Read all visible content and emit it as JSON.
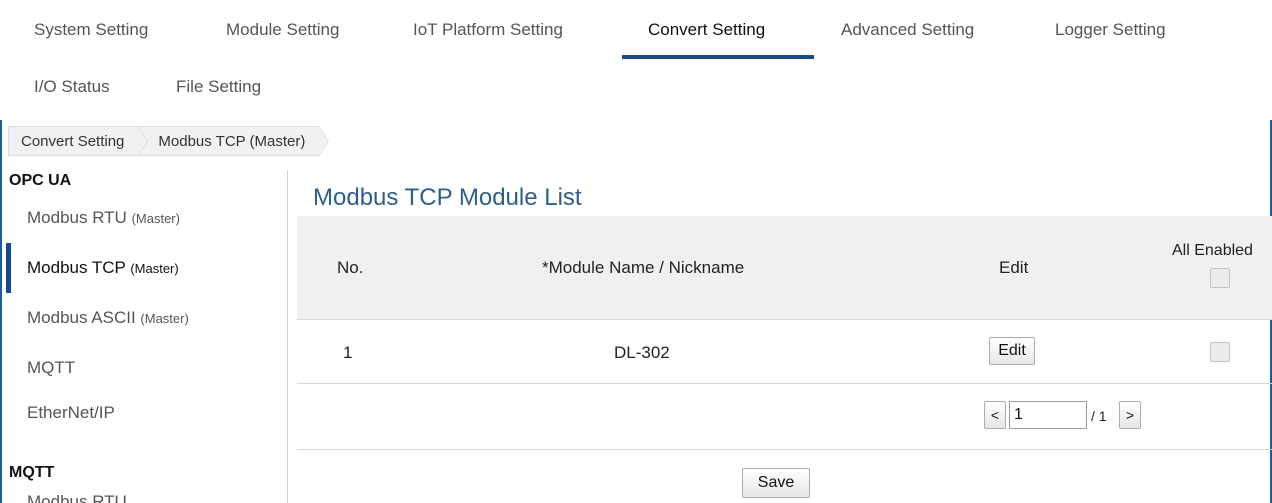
{
  "topnav": {
    "items": [
      {
        "label": "System Setting"
      },
      {
        "label": "Module Setting"
      },
      {
        "label": "IoT Platform Setting"
      },
      {
        "label": "Convert Setting"
      },
      {
        "label": "Advanced Setting"
      },
      {
        "label": "Logger Setting"
      },
      {
        "label": "I/O Status"
      },
      {
        "label": "File Setting"
      }
    ],
    "active": "Convert Setting"
  },
  "breadcrumb": [
    "Convert Setting",
    "Modbus TCP (Master)"
  ],
  "sidebar": {
    "sections": [
      {
        "heading": "OPC UA",
        "items": [
          {
            "label": "Modbus RTU",
            "sub": "(Master)"
          },
          {
            "label": "Modbus TCP",
            "sub": "(Master)",
            "active": true
          },
          {
            "label": "Modbus ASCII",
            "sub": "(Master)"
          },
          {
            "label": "MQTT",
            "sub": ""
          },
          {
            "label": "EtherNet/IP",
            "sub": ""
          }
        ]
      },
      {
        "heading": "MQTT",
        "items": [
          {
            "label": "Modbus RTU",
            "sub": ""
          }
        ]
      }
    ]
  },
  "main": {
    "title": "Modbus TCP Module List",
    "table": {
      "headers": {
        "no": "No.",
        "name": "*Module Name / Nickname",
        "edit": "Edit",
        "enabled": "All Enabled"
      },
      "rows": [
        {
          "no": "1",
          "name": "DL-302",
          "edit_label": "Edit",
          "enabled": false
        }
      ]
    },
    "pagination": {
      "prev": "<",
      "current": "1",
      "total": "/ 1",
      "next": ">"
    },
    "save_label": "Save"
  },
  "colors": {
    "accent": "#1c4a80",
    "title": "#2e5f8a",
    "frame": "#1c5aa8"
  }
}
